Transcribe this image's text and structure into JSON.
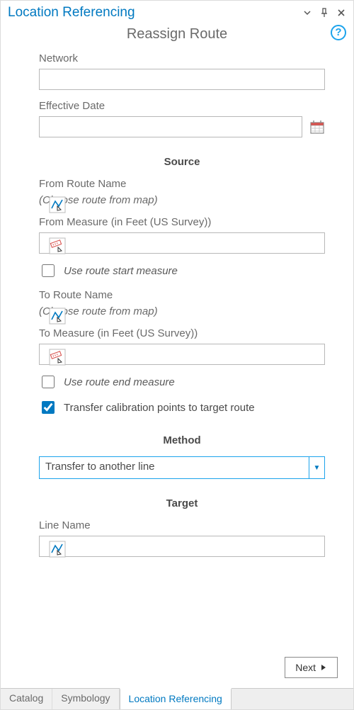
{
  "titlebar": {
    "title": "Location Referencing"
  },
  "subtitle": "Reassign Route",
  "fields": {
    "network_label": "Network",
    "network_value": "",
    "effective_date_label": "Effective Date",
    "effective_date_value": ""
  },
  "sections": {
    "source_heading": "Source",
    "method_heading": "Method",
    "target_heading": "Target"
  },
  "source": {
    "from_route_label": "From Route Name",
    "from_route_hint": "(Choose route from map)",
    "from_measure_label": "From Measure (in Feet (US Survey))",
    "from_measure_value": "",
    "use_start_label": "Use route start measure",
    "use_start_checked": false,
    "to_route_label": "To Route Name",
    "to_route_hint": "(Choose route from map)",
    "to_measure_label": "To Measure (in Feet (US Survey))",
    "to_measure_value": "",
    "use_end_label": "Use route end measure",
    "use_end_checked": false,
    "transfer_label": "Transfer calibration points to target route",
    "transfer_checked": true
  },
  "method": {
    "selected": "Transfer to another line"
  },
  "target": {
    "line_name_label": "Line Name",
    "line_name_value": ""
  },
  "footer": {
    "next_label": "Next"
  },
  "tabs": {
    "catalog": "Catalog",
    "symbology": "Symbology",
    "location_ref": "Location Referencing"
  },
  "icons": {
    "route_tool": "route-select-icon",
    "measure_tool": "measure-select-icon",
    "calendar": "calendar-icon",
    "help": "help-icon"
  }
}
